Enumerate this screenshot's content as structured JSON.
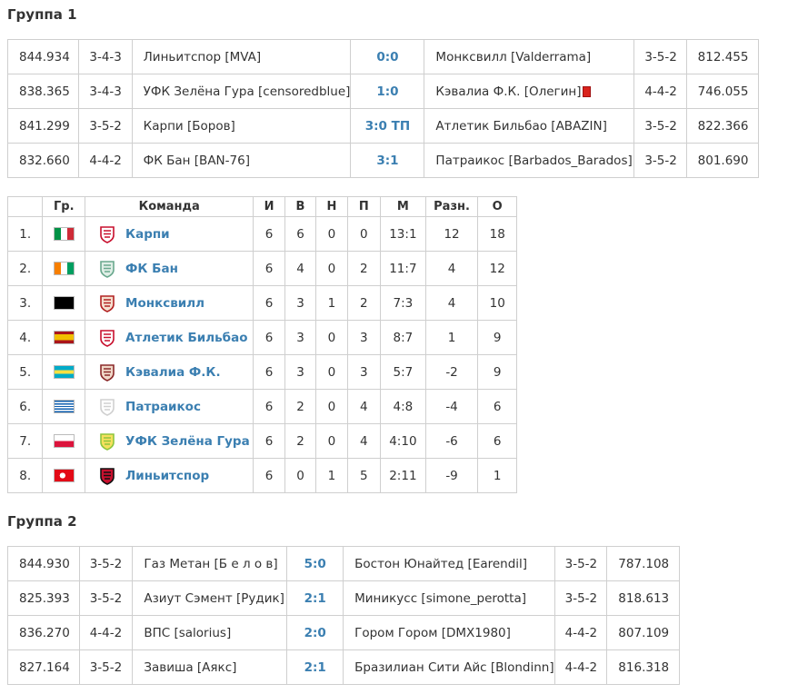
{
  "groups": [
    {
      "title": "Группа 1",
      "matches": [
        {
          "home_rating": "844.934",
          "home_form": "3-4-3",
          "home_team": "Линьитспор [MVA]",
          "score": "0:0",
          "away_team": "Монксвилл [Valderrama]",
          "away_form": "3-5-2",
          "away_rating": "812.455",
          "red_card": false
        },
        {
          "home_rating": "838.365",
          "home_form": "3-4-3",
          "home_team": "УФК Зелёна Гура [censoredblue]",
          "score": "1:0",
          "away_team": "Кэвалиа Ф.К. [Олегин]",
          "away_form": "4-4-2",
          "away_rating": "746.055",
          "red_card": true
        },
        {
          "home_rating": "841.299",
          "home_form": "3-5-2",
          "home_team": "Карпи [Боров]",
          "score": "3:0 ТП",
          "away_team": "Атлетик Бильбао [ABAZIN]",
          "away_form": "3-5-2",
          "away_rating": "822.366",
          "red_card": false
        },
        {
          "home_rating": "832.660",
          "home_form": "4-4-2",
          "home_team": "ФК Бан [BAN-76]",
          "score": "3:1",
          "away_team": "Патраикос [Barbados_Barados]",
          "away_form": "3-5-2",
          "away_rating": "801.690",
          "red_card": false
        }
      ],
      "standings": {
        "headers": [
          "",
          "Гр.",
          "Команда",
          "И",
          "В",
          "Н",
          "П",
          "М",
          "Разн.",
          "О"
        ],
        "rows": [
          {
            "pos": "1.",
            "country": "italy",
            "team": "Карпи",
            "logo": "carpi-logo",
            "played": "6",
            "won": "6",
            "drawn": "0",
            "lost": "0",
            "goals": "13:1",
            "diff": "12",
            "points": "18"
          },
          {
            "pos": "2.",
            "country": "ivory-coast",
            "team": "ФК Бан",
            "logo": "fk-ban-logo",
            "played": "6",
            "won": "4",
            "drawn": "0",
            "lost": "2",
            "goals": "11:7",
            "diff": "4",
            "points": "12"
          },
          {
            "pos": "3.",
            "country": "antigua-barbuda",
            "team": "Монксвилл",
            "logo": "monksville-logo",
            "played": "6",
            "won": "3",
            "drawn": "1",
            "lost": "2",
            "goals": "7:3",
            "diff": "4",
            "points": "10"
          },
          {
            "pos": "4.",
            "country": "spain",
            "team": "Атлетик Бильбао",
            "logo": "athletic-bilbao-logo",
            "played": "6",
            "won": "3",
            "drawn": "0",
            "lost": "3",
            "goals": "8:7",
            "diff": "1",
            "points": "9"
          },
          {
            "pos": "5.",
            "country": "bahamas",
            "team": "Кэвалиа Ф.К.",
            "logo": "cavalia-logo",
            "played": "6",
            "won": "3",
            "drawn": "0",
            "lost": "3",
            "goals": "5:7",
            "diff": "-2",
            "points": "9"
          },
          {
            "pos": "6.",
            "country": "greece",
            "team": "Патраикос",
            "logo": "patraikos-logo",
            "played": "6",
            "won": "2",
            "drawn": "0",
            "lost": "4",
            "goals": "4:8",
            "diff": "-4",
            "points": "6"
          },
          {
            "pos": "7.",
            "country": "poland",
            "team": "УФК Зелёна Гура",
            "logo": "ufk-zielona-gora-logo",
            "played": "6",
            "won": "2",
            "drawn": "0",
            "lost": "4",
            "goals": "4:10",
            "diff": "-6",
            "points": "6"
          },
          {
            "pos": "8.",
            "country": "turkey",
            "team": "Линьитспор",
            "logo": "linyitspor-logo",
            "played": "6",
            "won": "0",
            "drawn": "1",
            "lost": "5",
            "goals": "2:11",
            "diff": "-9",
            "points": "1"
          }
        ]
      }
    },
    {
      "title": "Группа 2",
      "matches": [
        {
          "home_rating": "844.930",
          "home_form": "3-5-2",
          "home_team": "Газ Метан [Б е л о в]",
          "score": "5:0",
          "away_team": "Бостон Юнайтед [Earendil]",
          "away_form": "3-5-2",
          "away_rating": "787.108"
        },
        {
          "home_rating": "825.393",
          "home_form": "3-5-2",
          "home_team": "Азиут Сэмент [Рудик]",
          "score": "2:1",
          "away_team": "Миникусс [simone_perotta]",
          "away_form": "3-5-2",
          "away_rating": "818.613"
        },
        {
          "home_rating": "836.270",
          "home_form": "4-4-2",
          "home_team": "ВПС [salorius]",
          "score": "2:0",
          "away_team": "Гором Гором [DMX1980]",
          "away_form": "4-4-2",
          "away_rating": "807.109"
        },
        {
          "home_rating": "827.164",
          "home_form": "3-5-2",
          "home_team": "Завиша [Аякс]",
          "score": "2:1",
          "away_team": "Бразилиан Сити Айс [Blondinn]",
          "away_form": "4-4-2",
          "away_rating": "816.318"
        }
      ]
    }
  ],
  "colors": {
    "link": "#3b7fb1",
    "border": "#cfcfcf",
    "red_card": "#d9231c"
  }
}
